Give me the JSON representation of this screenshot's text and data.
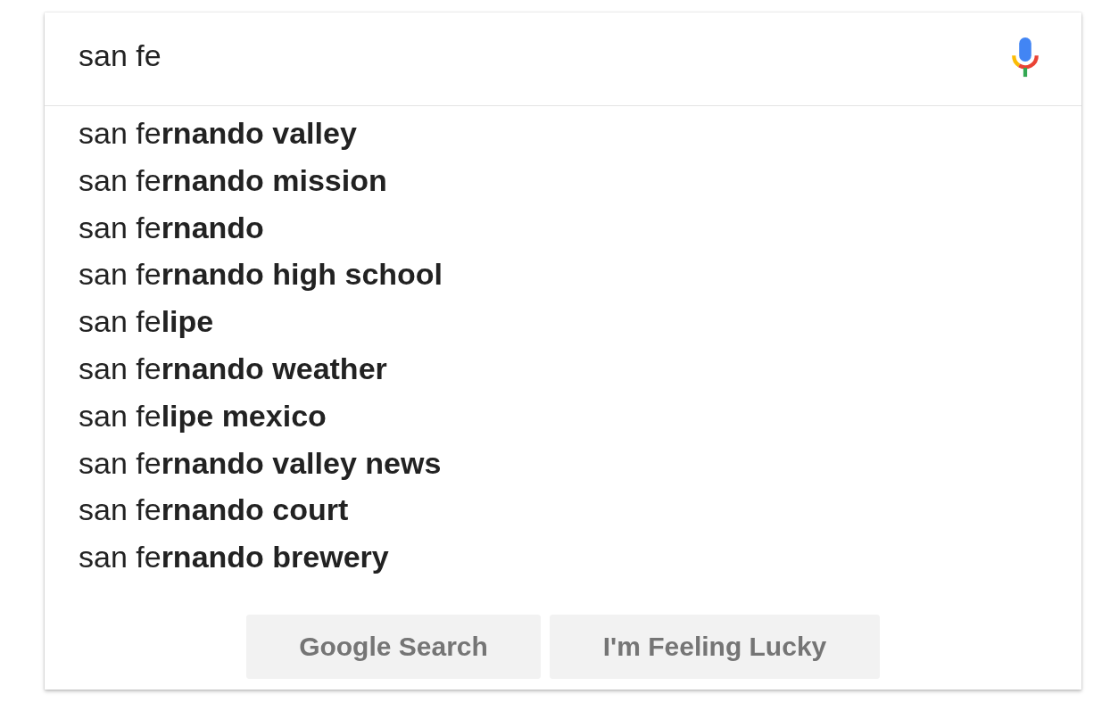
{
  "search": {
    "value": "san fe"
  },
  "suggestions": [
    "san fe**rnando valley**",
    "san fe**rnando mission**",
    "san fe**rnando**",
    "san fe**rnando high school**",
    "san fe**lipe**",
    "san fe**rnando weather**",
    "san fe**lipe mexico**",
    "san fe**rnando valley news**",
    "san fe**rnando court**",
    "san fe**rnando brewery**"
  ],
  "buttons": [
    "Google Search",
    "I'm Feeling Lucky"
  ]
}
